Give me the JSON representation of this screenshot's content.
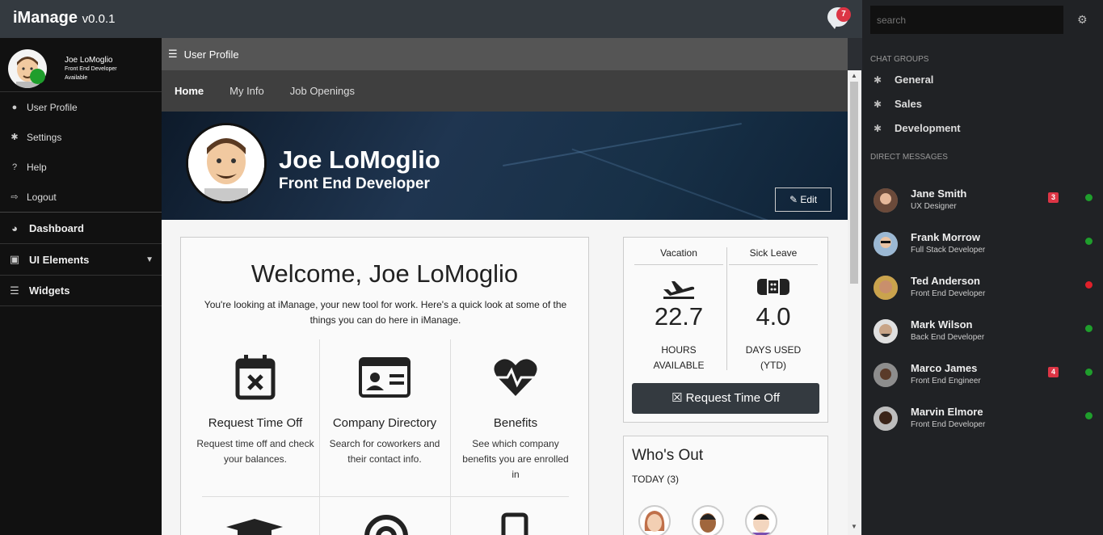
{
  "app": {
    "name": "iManage",
    "version": "v0.0.1",
    "notification_count": "7"
  },
  "sidebar": {
    "user": {
      "name": "Joe LoMoglio",
      "role": "Front End Developer",
      "status": "Available"
    },
    "items": [
      {
        "label": "User Profile",
        "icon": "user-icon"
      },
      {
        "label": "Settings",
        "icon": "gear-icon"
      },
      {
        "label": "Help",
        "icon": "help-icon"
      },
      {
        "label": "Logout",
        "icon": "logout-icon"
      }
    ],
    "sections": [
      {
        "label": "Dashboard",
        "icon": "dashboard-icon"
      },
      {
        "label": "UI Elements",
        "icon": "monitor-icon"
      },
      {
        "label": "Widgets",
        "icon": "list-icon"
      }
    ]
  },
  "page": {
    "header": "User Profile",
    "tabs": [
      "Home",
      "My Info",
      "Job Openings"
    ],
    "active_tab": "Home"
  },
  "hero": {
    "name": "Joe LoMoglio",
    "title": "Front End Developer",
    "edit_label": "Edit"
  },
  "welcome": {
    "title": "Welcome, Joe LoMoglio",
    "text": "You're looking at iManage, your new tool for work. Here's a quick look at some of the things you can do here in iManage.",
    "features": [
      {
        "title": "Request Time Off",
        "desc": "Request time off and check your balances.",
        "icon": "calendar-x-icon"
      },
      {
        "title": "Company Directory",
        "desc": "Search for coworkers and their contact info.",
        "icon": "id-card-icon"
      },
      {
        "title": "Benefits",
        "desc": "See which company benefits you are enrolled in",
        "icon": "heartbeat-icon"
      }
    ]
  },
  "leave": {
    "vacation": {
      "label": "Vacation",
      "value": "22.7",
      "unit_line1": "HOURS",
      "unit_line2": "AVAILABLE",
      "icon": "plane-icon"
    },
    "sick": {
      "label": "Sick Leave",
      "value": "4.0",
      "unit_line1": "DAYS USED",
      "unit_line2": "(YTD)",
      "icon": "bandage-icon"
    },
    "button": "Request Time Off"
  },
  "whos_out": {
    "title": "Who's Out",
    "today": "TODAY (3)"
  },
  "chat": {
    "search_placeholder": "search",
    "groups_header": "CHAT GROUPS",
    "groups": [
      "General",
      "Sales",
      "Development"
    ],
    "dm_header": "DIRECT MESSAGES",
    "dms": [
      {
        "name": "Jane Smith",
        "role": "UX Designer",
        "badge": "3",
        "status": "online"
      },
      {
        "name": "Frank Morrow",
        "role": "Full Stack Developer",
        "badge": "",
        "status": "online"
      },
      {
        "name": "Ted Anderson",
        "role": "Front End Developer",
        "badge": "",
        "status": "busy"
      },
      {
        "name": "Mark Wilson",
        "role": "Back End Developer",
        "badge": "",
        "status": "online"
      },
      {
        "name": "Marco James",
        "role": "Front End Engineer",
        "badge": "4",
        "status": "online"
      },
      {
        "name": "Marvin Elmore",
        "role": "Front End Developer",
        "badge": "",
        "status": "online"
      }
    ]
  },
  "colors": {
    "accent_dark": "#343a40",
    "badge_red": "#dc3545",
    "online_green": "#1f9e2c",
    "busy_red": "#e0202a"
  }
}
